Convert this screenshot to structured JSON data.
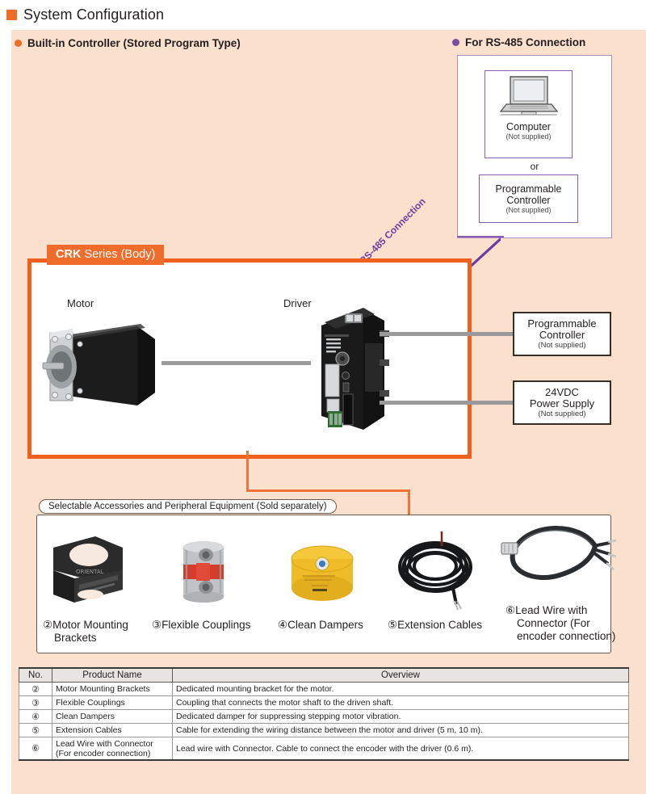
{
  "header": {
    "title": "System Configuration",
    "marker_color": "#ef6c2a"
  },
  "sections": {
    "built_in": {
      "label": "Built-in Controller (Stored Program Type)",
      "bullet_color": "#ef6c2a"
    },
    "rs485": {
      "label": "For RS-485 Connection",
      "bullet_color": "#7b4f9d"
    }
  },
  "rs485_card": {
    "computer": {
      "icon": "laptop-icon",
      "label": "Computer",
      "note": "(Not supplied)"
    },
    "or": "or",
    "plc": {
      "line1": "Programmable",
      "line2": "Controller",
      "note": "(Not supplied)"
    }
  },
  "crk_box": {
    "tab_bold": "CRK",
    "tab_rest": " Series (Body)",
    "motor_label": "Motor",
    "driver_label": "Driver",
    "rs485_line_label": "RS-485 Connection",
    "border_color": "#ef5f1e"
  },
  "side_boxes": [
    {
      "title_line1": "Programmable",
      "title_line2": "Controller",
      "note": "(Not supplied)"
    },
    {
      "title_line1": "24VDC",
      "title_line2": "Power Supply",
      "note": "(Not supplied)"
    }
  ],
  "accessories": {
    "tab_label": "Selectable Accessories and Peripheral Equipment (Sold separately)",
    "items": [
      {
        "num": "②",
        "icon": "motor-mounting-bracket-icon",
        "line1": "Motor Mounting",
        "line2": "Brackets",
        "line3": ""
      },
      {
        "num": "③",
        "icon": "flexible-coupling-icon",
        "line1": "Flexible Couplings",
        "line2": "",
        "line3": ""
      },
      {
        "num": "④",
        "icon": "clean-damper-icon",
        "line1": "Clean Dampers",
        "line2": "",
        "line3": ""
      },
      {
        "num": "⑤",
        "icon": "extension-cable-icon",
        "line1": "Extension Cables",
        "line2": "",
        "line3": ""
      },
      {
        "num": "⑥",
        "icon": "lead-wire-connector-icon",
        "line1": "Lead Wire with",
        "line2": "Connector (For",
        "line3": "encoder connection)"
      }
    ]
  },
  "table": {
    "headers": {
      "no": "No.",
      "name": "Product Name",
      "overview": "Overview"
    },
    "rows": [
      {
        "no": "②",
        "name": "Motor Mounting Brackets",
        "name2": "",
        "overview": "Dedicated mounting bracket for the motor."
      },
      {
        "no": "③",
        "name": "Flexible Couplings",
        "name2": "",
        "overview": "Coupling that connects the motor shaft to the driven shaft."
      },
      {
        "no": "④",
        "name": "Clean Dampers",
        "name2": "",
        "overview": "Dedicated damper for suppressing stepping motor vibration."
      },
      {
        "no": "⑤",
        "name": "Extension Cables",
        "name2": "",
        "overview": "Cable for extending the wiring distance between the motor and driver (5 m, 10 m)."
      },
      {
        "no": "⑥",
        "name": "Lead Wire with Connector",
        "name2": "(For encoder connection)",
        "overview": "Lead wire with Connector. Cable to connect the encoder with the driver (0.6 m)."
      }
    ]
  }
}
